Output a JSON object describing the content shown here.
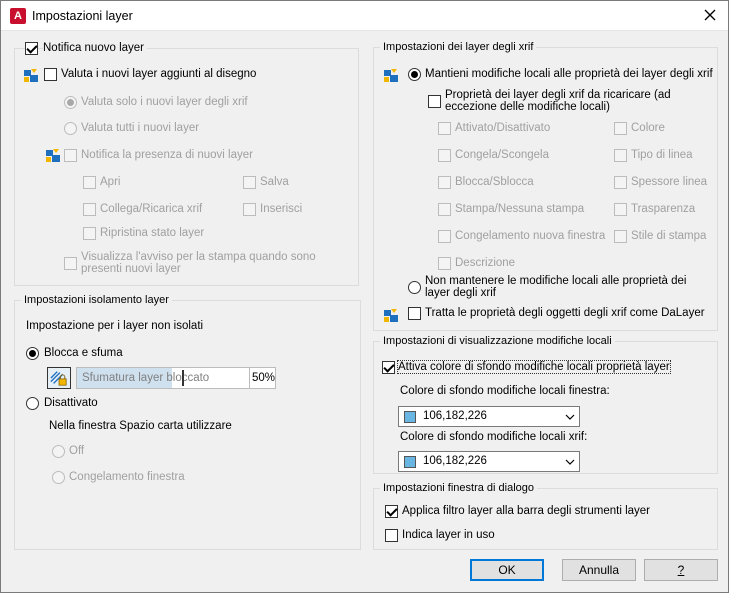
{
  "window": {
    "title": "Impostazioni layer",
    "app_icon_letter": "A"
  },
  "new_layer": {
    "notify_label": "Notifica nuovo layer",
    "notify_checked": true,
    "evaluate_label": "Valuta i nuovi layer aggiunti al disegno",
    "evaluate_checked": false,
    "xref_only_label": "Valuta solo i nuovi layer degli xrif",
    "all_new_label": "Valuta tutti i nuovi layer",
    "notify_presence_label": "Notifica la presenza di nuovi layer",
    "ops": {
      "open": "Apri",
      "save": "Salva",
      "attach_reload": "Collega/Ricarica xrif",
      "insert": "Inserisci",
      "restore_state": "Ripristina stato layer"
    },
    "plot_warning_line1": "Visualizza l'avviso per la stampa quando sono",
    "plot_warning_line2": "presenti nuovi layer"
  },
  "isolation": {
    "legend": "Impostazioni isolamento layer",
    "heading": "Impostazione per i layer non isolati",
    "lock_fade_label": "Blocca e sfuma",
    "lock_fade_selected": true,
    "fade_field_label": "Sfumatura layer bloccato",
    "fade_value": "50%",
    "fade_fraction": 0.5,
    "off_label": "Disattivato",
    "paper_space_heading": "Nella finestra Spazio carta utilizzare",
    "paper_off_label": "Off",
    "paper_freeze_label": "Congelamento finestra"
  },
  "xref": {
    "legend": "Impostazioni dei layer degli xrif",
    "retain_label": "Mantieni modifiche locali alle proprietà dei layer degli xrif",
    "retain_selected": true,
    "reload_label_line1": "Proprietà dei layer degli xrif da ricaricare (ad",
    "reload_label_line2": "eccezione delle modifiche locali)",
    "props_left": [
      "Attivato/Disattivato",
      "Congela/Scongela",
      "Blocca/Sblocca",
      "Stampa/Nessuna stampa",
      "Congelamento nuova finestra",
      "Descrizione"
    ],
    "props_right": [
      "Colore",
      "Tipo di linea",
      "Spessore linea",
      "Trasparenza",
      "Stile di stampa"
    ],
    "no_retain_line1": "Non mantenere le modifiche locali alle proprietà dei",
    "no_retain_line2": "layer degli xrif",
    "bylayer_label": "Tratta le proprietà degli oggetti degli xrif come DaLayer"
  },
  "display": {
    "legend": "Impostazioni di visualizzazione modifiche locali",
    "enable_label": "Attiva colore di sfondo modifiche locali proprietà layer",
    "enable_checked": true,
    "viewport_bg_label": "Colore di sfondo modifiche locali finestra:",
    "viewport_color": "106,182,226",
    "xref_bg_label": "Colore di sfondo modifiche locali xrif:",
    "xref_color": "106,182,226",
    "swatch_color": "#6ab6e2"
  },
  "dialog_settings": {
    "legend": "Impostazioni finestra di dialogo",
    "apply_filter_label": "Applica filtro layer alla barra degli strumenti layer",
    "apply_filter_checked": true,
    "indicate_in_use_label": "Indica layer in uso",
    "indicate_in_use_checked": false
  },
  "buttons": {
    "ok": "OK",
    "cancel": "Annulla",
    "help": "?"
  },
  "colors": {
    "accent": "#0078d7",
    "app_red": "#c8102e"
  }
}
